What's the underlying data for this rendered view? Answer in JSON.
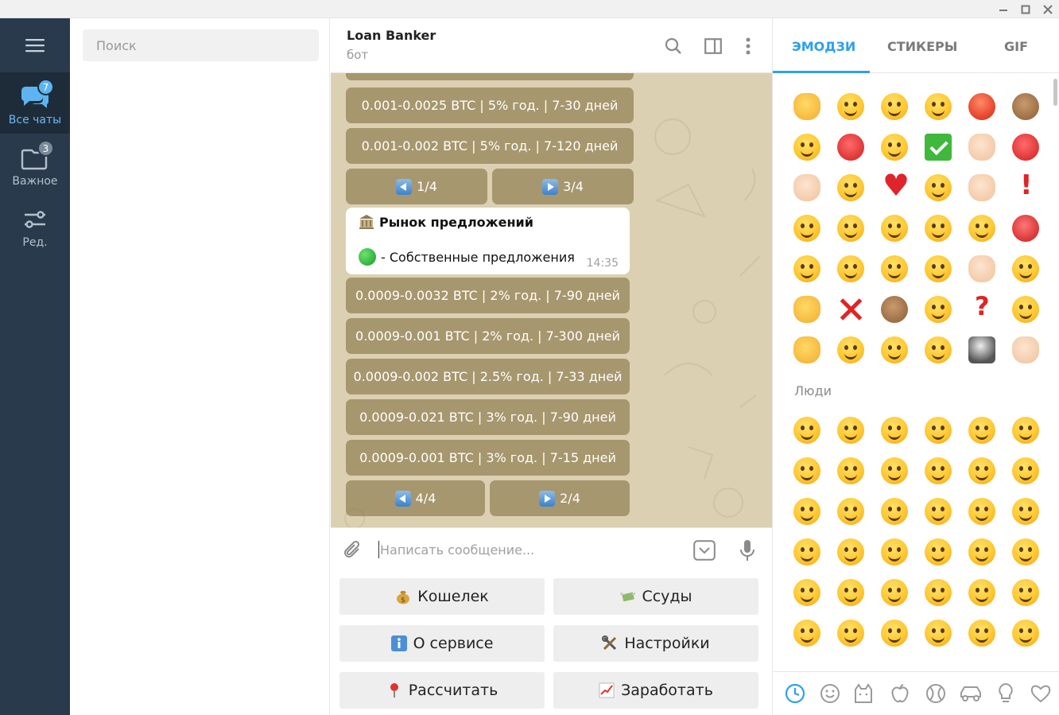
{
  "window": {
    "minimize_label": "minimize",
    "maximize_label": "maximize",
    "close_label": "close"
  },
  "rail": {
    "menu_icon": "hamburger-icon",
    "items": [
      {
        "label": "Все чаты",
        "badge": "7",
        "icon": "chats-icon",
        "active": true
      },
      {
        "label": "Важное",
        "badge": "3",
        "icon": "folder-icon",
        "active": false
      },
      {
        "label": "Ред.",
        "badge": "",
        "icon": "sliders-icon",
        "active": false
      }
    ]
  },
  "chatlist": {
    "search_placeholder": "Поиск"
  },
  "chat": {
    "title": "Loan Banker",
    "subtitle": "бот",
    "inline_top": [
      {
        "label": "0.001-0.0025 BTC | 5% год. | 7-30 дней"
      },
      {
        "label": "0.001-0.002 BTC | 5% год. | 7-120 дней"
      }
    ],
    "nav_top": {
      "prev": "1/4",
      "next": "3/4"
    },
    "message": {
      "title": "Рынок предложений",
      "line": "- Собственные предложения",
      "time": "14:35"
    },
    "inline_bottom": [
      {
        "label": "0.0009-0.0032 BTC | 2% год. | 7-90 дней"
      },
      {
        "label": "0.0009-0.001 BTC | 2% год. | 7-300 дней"
      },
      {
        "label": "0.0009-0.002 BTC | 2.5% год. | 7-33 дней"
      },
      {
        "label": "0.0009-0.021 BTC | 3% год. | 7-90 дней"
      },
      {
        "label": "0.0009-0.001 BTC | 3% год. | 7-15 дней"
      }
    ],
    "nav_bottom": {
      "prev": "4/4",
      "next": "2/4"
    },
    "composer_placeholder": "Написать сообщение...",
    "reply_keyboard": [
      {
        "emoji": "💰",
        "label": "Кошелек"
      },
      {
        "emoji": "💸",
        "label": "Ссуды"
      },
      {
        "emoji": "ℹ",
        "label": "О сервисе"
      },
      {
        "emoji": "🛠",
        "label": "Настройки"
      },
      {
        "emoji": "📍",
        "label": "Рассчитать"
      },
      {
        "emoji": "📈",
        "label": "Заработать"
      }
    ]
  },
  "emoji_panel": {
    "tabs": [
      "ЭМОДЗИ",
      "СТИКЕРЫ",
      "GIF"
    ],
    "active_tab": "ЭМОДЗИ",
    "section_people": "Люди",
    "categories": [
      "recent-clock-icon",
      "smiley-icon",
      "cat-icon",
      "apple-icon",
      "ball-icon",
      "car-icon",
      "bulb-icon",
      "heart-icon"
    ]
  },
  "colors": {
    "accent": "#2ea0ec",
    "rail_bg": "#293a4c",
    "rail_active": "#1e2c3a",
    "chat_bg": "#dcd0b2",
    "inline_button": "#9a8658"
  }
}
